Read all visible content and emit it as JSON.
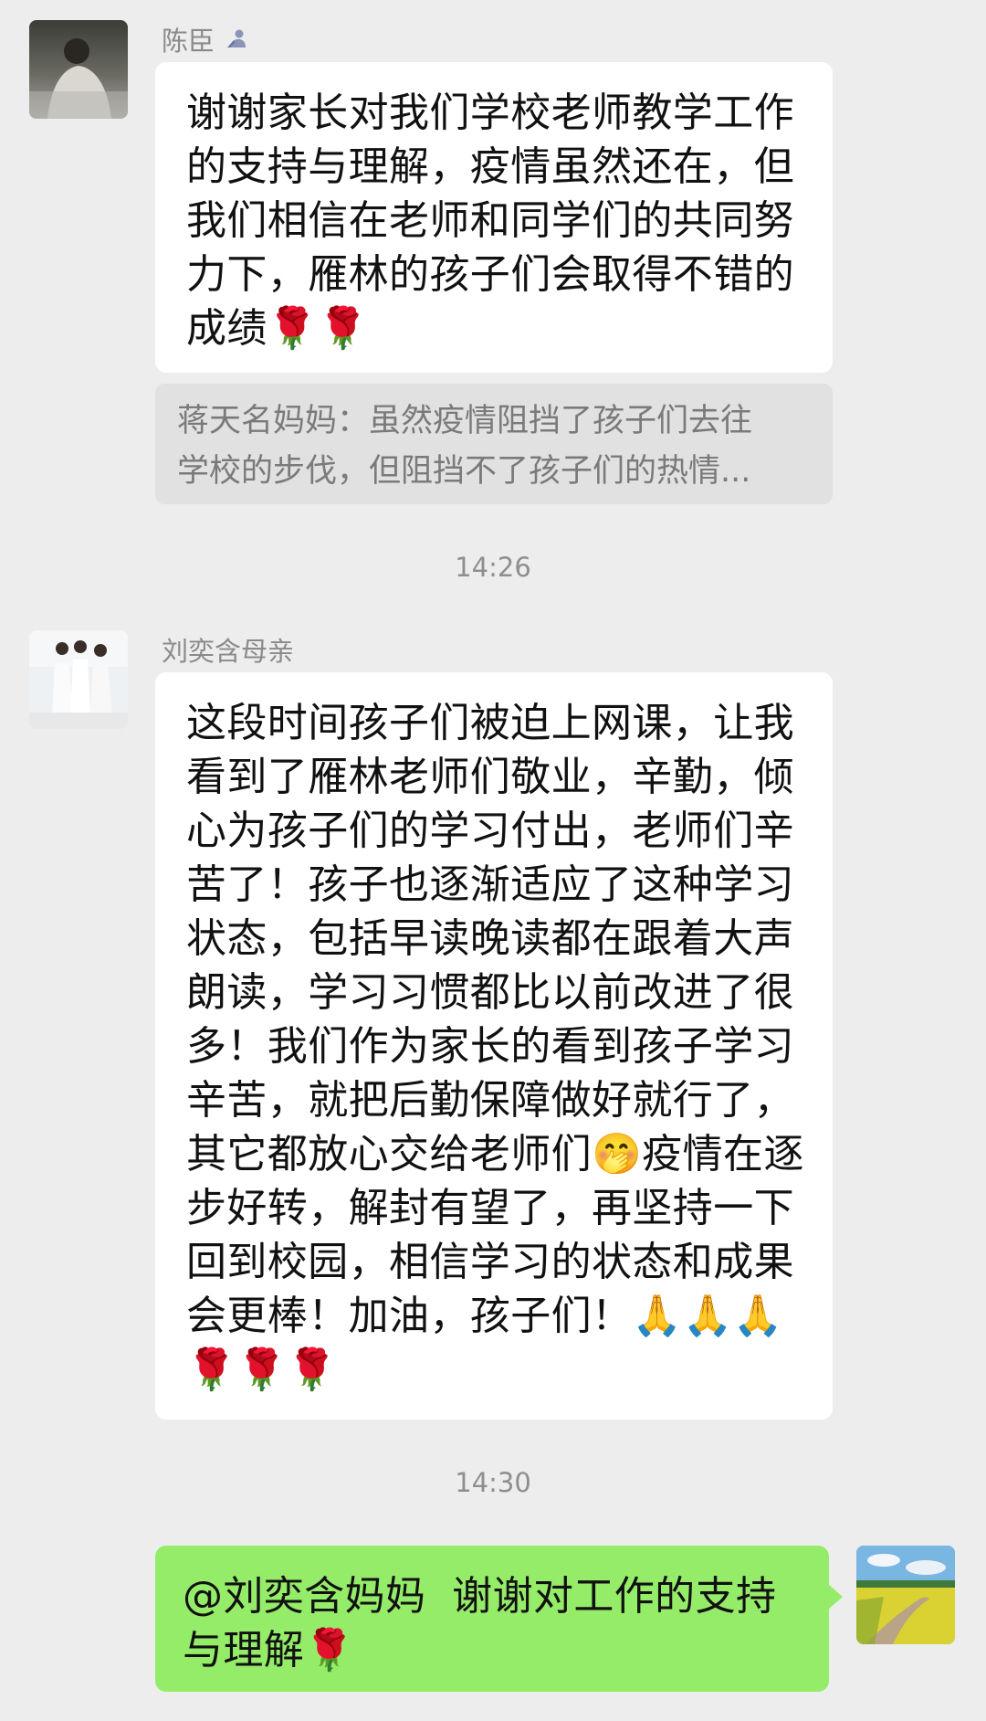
{
  "messages": [
    {
      "sender": "陈臣",
      "sender_badge_icon": "person-badge-icon",
      "text": "谢谢家长对我们学校老师教学工作\n的支持与理解，疫情虽然还在，但\n我们相信在老师和同学们的共同努\n力下，雁林的孩子们会取得不错的\n成绩🌹🌹",
      "quote": "蒋天名妈妈：虽然疫情阻挡了孩子们去往\n学校的步伐，但阻挡不了孩子们的热情..."
    },
    {
      "time": "14:26"
    },
    {
      "sender": "刘奕含母亲",
      "text": "这段时间孩子们被迫上网课，让我\n看到了雁林老师们敬业，辛勤，倾\n心为孩子们的学习付出，老师们辛\n苦了！孩子也逐渐适应了这种学习\n状态，包括早读晚读都在跟着大声\n朗读，学习习惯都比以前改进了很\n多！我们作为家长的看到孩子学习\n辛苦，就把后勤保障做好就行了，\n其它都放心交给老师们🤭疫情在逐\n步好转，解封有望了，再坚持一下\n回到校园，相信学习的状态和成果\n会更棒！加油，孩子们！🙏🙏🙏\n🌹🌹🌹"
    },
    {
      "time": "14:30"
    },
    {
      "self": true,
      "text": "@刘奕含妈妈  谢谢对工作的支持\n与理解🌹"
    }
  ],
  "colors": {
    "background": "#ededed",
    "bubble_in": "#ffffff",
    "bubble_out": "#95ec69",
    "quote_bg": "#e1e1e1"
  }
}
